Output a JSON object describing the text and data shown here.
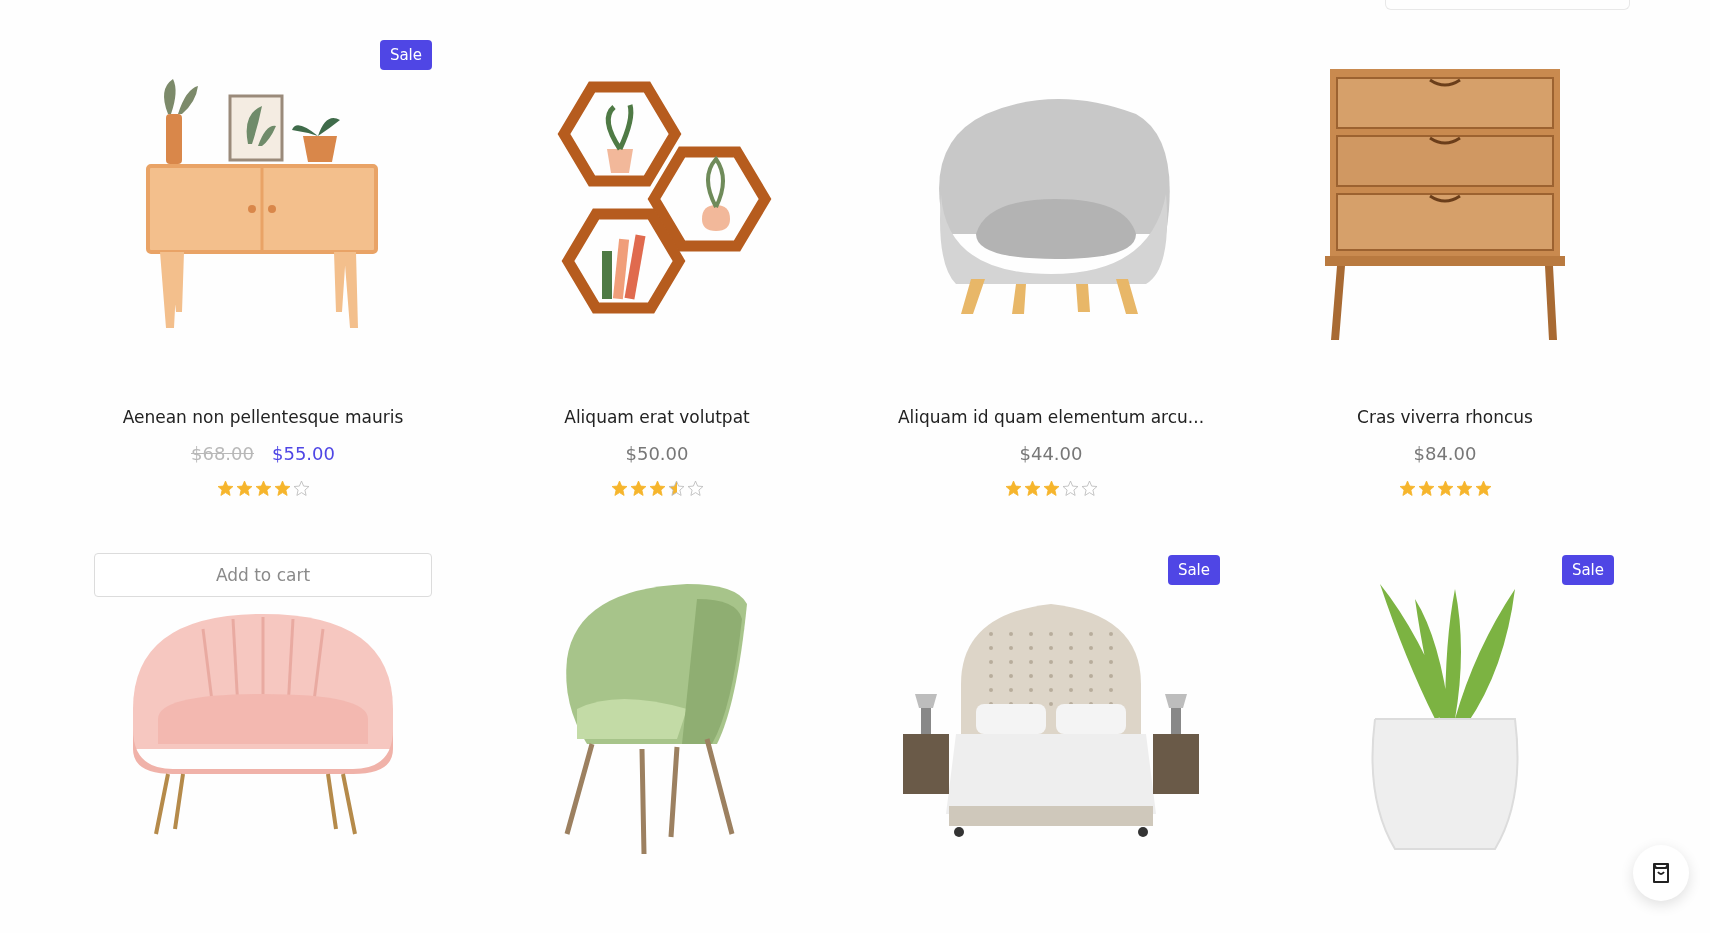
{
  "products": [
    {
      "kind": "cabinet",
      "badge": "Sale",
      "title": "Aenean non pellentesque mauris",
      "old_price": "$68.00",
      "price": "$55.00",
      "stars": 4
    },
    {
      "kind": "hexagon-shelf",
      "title": "Aliquam erat volutpat",
      "price": "$50.00",
      "stars": 3.5
    },
    {
      "kind": "gray-armchair",
      "title": "Aliquam id quam elementum arcu...",
      "price": "$44.00",
      "stars": 3
    },
    {
      "kind": "dresser",
      "title": "Cras viverra rhoncus",
      "price": "$84.00",
      "stars": 5
    },
    {
      "kind": "pink-armchair",
      "add_to_cart": "Add to cart"
    },
    {
      "kind": "green-chair"
    },
    {
      "kind": "bed",
      "badge": "Sale"
    },
    {
      "kind": "potted-plant",
      "badge": "Sale"
    }
  ]
}
